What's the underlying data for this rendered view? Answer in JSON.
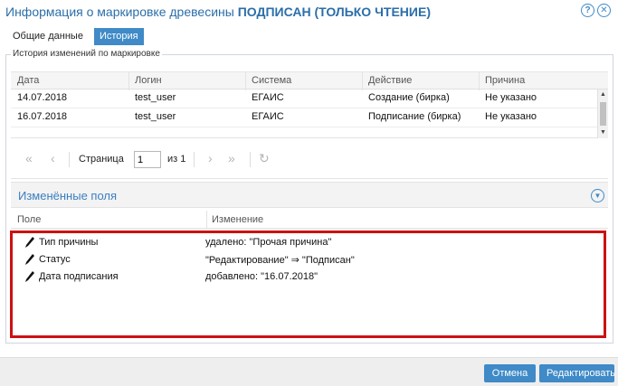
{
  "window": {
    "title_prefix": "Информация о маркировке древесины",
    "title_status": "ПОДПИСАН",
    "title_mode": "(ТОЛЬКО ЧТЕНИЕ)",
    "help_glyph": "?",
    "close_glyph": "✕"
  },
  "tabs": [
    {
      "label": "Общие данные",
      "active": false
    },
    {
      "label": "История",
      "active": true
    }
  ],
  "history": {
    "legend": "История изменений по маркировке",
    "columns": [
      "Дата",
      "Логин",
      "Система",
      "Действие",
      "Причина"
    ],
    "rows": [
      [
        "14.07.2018",
        "test_user",
        "ЕГАИС",
        "Создание (бирка)",
        "Не указано"
      ],
      [
        "16.07.2018",
        "test_user",
        "ЕГАИС",
        "Подписание (бирка)",
        "Не указано"
      ]
    ]
  },
  "pager": {
    "page_label": "Страница",
    "page_value": "1",
    "of_label": "из 1",
    "first_icon": "double-chevron-left-icon",
    "prev_icon": "chevron-left-icon",
    "next_icon": "chevron-right-icon",
    "last_icon": "double-chevron-right-icon",
    "refresh_icon": "refresh-icon"
  },
  "changed_fields": {
    "title": "Изменённые поля",
    "columns": [
      "Поле",
      "Изменение"
    ],
    "rows": [
      {
        "field": "Тип причины",
        "change": "удалено: \"Прочая причина\""
      },
      {
        "field": "Статус",
        "change": "\"Редактирование\" ⇒ \"Подписан\""
      },
      {
        "field": "Дата подписания",
        "change": "добавлено: \"16.07.2018\""
      }
    ]
  },
  "footer": {
    "cancel_label": "Отмена",
    "edit_label": "Редактировать"
  },
  "colors": {
    "accent": "#3f8ac7",
    "title": "#2b6ea9",
    "highlight_border": "#cc1111"
  }
}
